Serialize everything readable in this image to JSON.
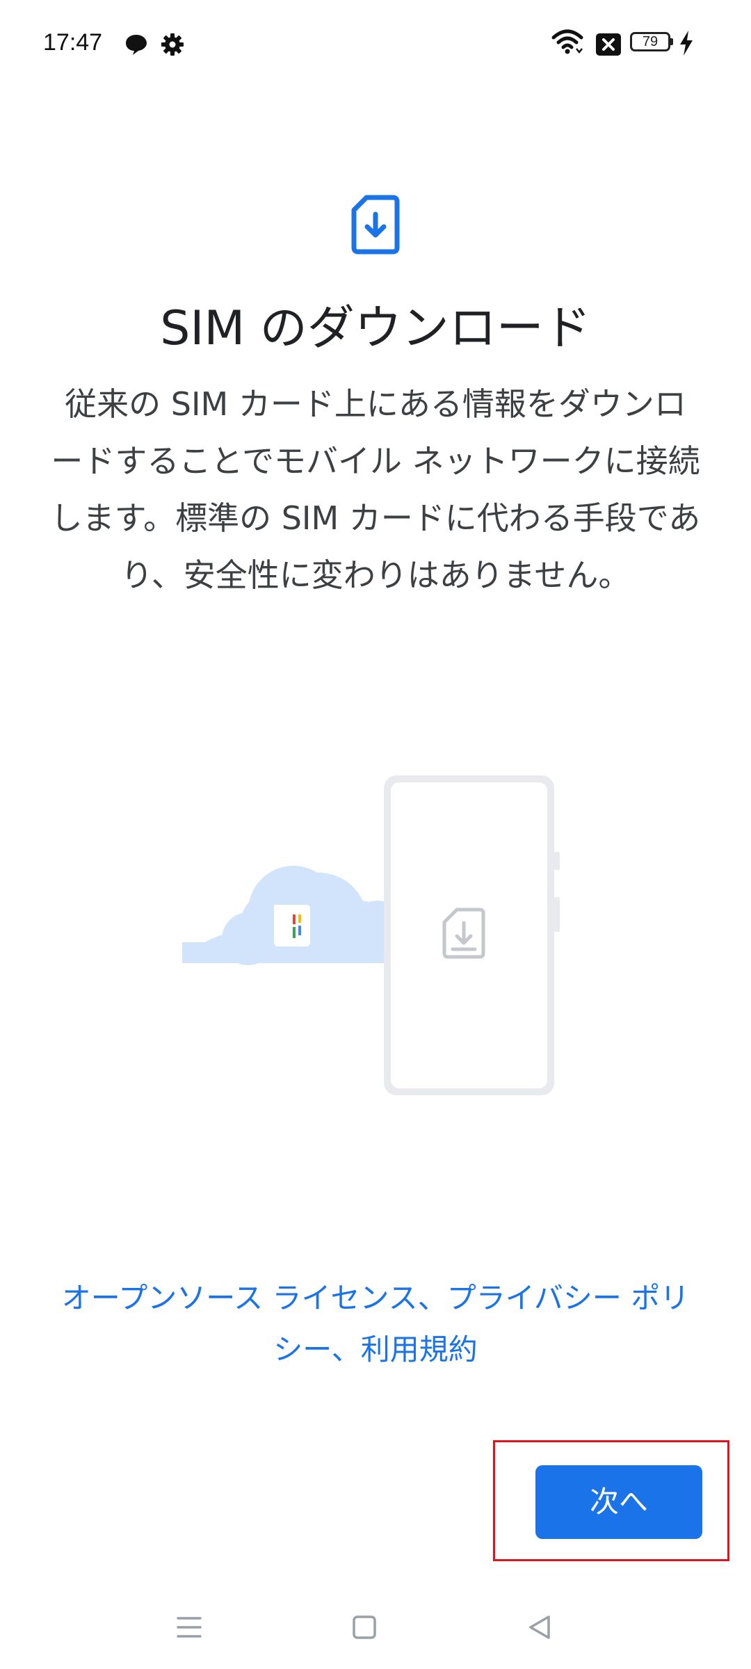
{
  "status_bar": {
    "time": "17:47",
    "battery_level": "79",
    "icons": [
      "chat-bubble-icon",
      "gear-icon",
      "wifi-icon",
      "sim-blocked-icon",
      "battery-icon",
      "charging-bolt-icon"
    ]
  },
  "main": {
    "icon": "sim-download-icon",
    "title": "SIM のダウンロード",
    "description": "従来の SIM カード上にある情報をダウンロードすることでモバイル ネットワークに接続します。標準の SIM カードに代わる手段であり、安全性に変わりはありません。",
    "illustration": "cloud-to-phone-sim-illustration"
  },
  "links": {
    "open_source": "オープンソース ライセンス",
    "sep1": "、",
    "privacy": "プライバシー ポリシー",
    "sep2": "、",
    "terms": "利用規約"
  },
  "actions": {
    "next_label": "次へ"
  },
  "colors": {
    "accent": "#1a73e8",
    "highlight": "#e0141e",
    "cloud": "#d2e3fc"
  },
  "nav_bar": {
    "items": [
      "menu-icon",
      "home-icon",
      "back-icon"
    ]
  }
}
